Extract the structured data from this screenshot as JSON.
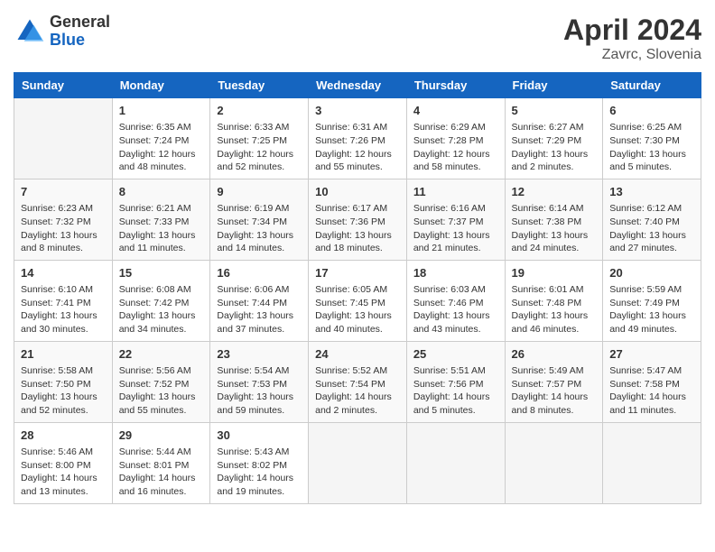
{
  "header": {
    "logo_general": "General",
    "logo_blue": "Blue",
    "month_year": "April 2024",
    "location": "Zavrc, Slovenia"
  },
  "days_of_week": [
    "Sunday",
    "Monday",
    "Tuesday",
    "Wednesday",
    "Thursday",
    "Friday",
    "Saturday"
  ],
  "weeks": [
    [
      {
        "day": "",
        "content": ""
      },
      {
        "day": "1",
        "content": "Sunrise: 6:35 AM\nSunset: 7:24 PM\nDaylight: 12 hours\nand 48 minutes."
      },
      {
        "day": "2",
        "content": "Sunrise: 6:33 AM\nSunset: 7:25 PM\nDaylight: 12 hours\nand 52 minutes."
      },
      {
        "day": "3",
        "content": "Sunrise: 6:31 AM\nSunset: 7:26 PM\nDaylight: 12 hours\nand 55 minutes."
      },
      {
        "day": "4",
        "content": "Sunrise: 6:29 AM\nSunset: 7:28 PM\nDaylight: 12 hours\nand 58 minutes."
      },
      {
        "day": "5",
        "content": "Sunrise: 6:27 AM\nSunset: 7:29 PM\nDaylight: 13 hours\nand 2 minutes."
      },
      {
        "day": "6",
        "content": "Sunrise: 6:25 AM\nSunset: 7:30 PM\nDaylight: 13 hours\nand 5 minutes."
      }
    ],
    [
      {
        "day": "7",
        "content": "Sunrise: 6:23 AM\nSunset: 7:32 PM\nDaylight: 13 hours\nand 8 minutes."
      },
      {
        "day": "8",
        "content": "Sunrise: 6:21 AM\nSunset: 7:33 PM\nDaylight: 13 hours\nand 11 minutes."
      },
      {
        "day": "9",
        "content": "Sunrise: 6:19 AM\nSunset: 7:34 PM\nDaylight: 13 hours\nand 14 minutes."
      },
      {
        "day": "10",
        "content": "Sunrise: 6:17 AM\nSunset: 7:36 PM\nDaylight: 13 hours\nand 18 minutes."
      },
      {
        "day": "11",
        "content": "Sunrise: 6:16 AM\nSunset: 7:37 PM\nDaylight: 13 hours\nand 21 minutes."
      },
      {
        "day": "12",
        "content": "Sunrise: 6:14 AM\nSunset: 7:38 PM\nDaylight: 13 hours\nand 24 minutes."
      },
      {
        "day": "13",
        "content": "Sunrise: 6:12 AM\nSunset: 7:40 PM\nDaylight: 13 hours\nand 27 minutes."
      }
    ],
    [
      {
        "day": "14",
        "content": "Sunrise: 6:10 AM\nSunset: 7:41 PM\nDaylight: 13 hours\nand 30 minutes."
      },
      {
        "day": "15",
        "content": "Sunrise: 6:08 AM\nSunset: 7:42 PM\nDaylight: 13 hours\nand 34 minutes."
      },
      {
        "day": "16",
        "content": "Sunrise: 6:06 AM\nSunset: 7:44 PM\nDaylight: 13 hours\nand 37 minutes."
      },
      {
        "day": "17",
        "content": "Sunrise: 6:05 AM\nSunset: 7:45 PM\nDaylight: 13 hours\nand 40 minutes."
      },
      {
        "day": "18",
        "content": "Sunrise: 6:03 AM\nSunset: 7:46 PM\nDaylight: 13 hours\nand 43 minutes."
      },
      {
        "day": "19",
        "content": "Sunrise: 6:01 AM\nSunset: 7:48 PM\nDaylight: 13 hours\nand 46 minutes."
      },
      {
        "day": "20",
        "content": "Sunrise: 5:59 AM\nSunset: 7:49 PM\nDaylight: 13 hours\nand 49 minutes."
      }
    ],
    [
      {
        "day": "21",
        "content": "Sunrise: 5:58 AM\nSunset: 7:50 PM\nDaylight: 13 hours\nand 52 minutes."
      },
      {
        "day": "22",
        "content": "Sunrise: 5:56 AM\nSunset: 7:52 PM\nDaylight: 13 hours\nand 55 minutes."
      },
      {
        "day": "23",
        "content": "Sunrise: 5:54 AM\nSunset: 7:53 PM\nDaylight: 13 hours\nand 59 minutes."
      },
      {
        "day": "24",
        "content": "Sunrise: 5:52 AM\nSunset: 7:54 PM\nDaylight: 14 hours\nand 2 minutes."
      },
      {
        "day": "25",
        "content": "Sunrise: 5:51 AM\nSunset: 7:56 PM\nDaylight: 14 hours\nand 5 minutes."
      },
      {
        "day": "26",
        "content": "Sunrise: 5:49 AM\nSunset: 7:57 PM\nDaylight: 14 hours\nand 8 minutes."
      },
      {
        "day": "27",
        "content": "Sunrise: 5:47 AM\nSunset: 7:58 PM\nDaylight: 14 hours\nand 11 minutes."
      }
    ],
    [
      {
        "day": "28",
        "content": "Sunrise: 5:46 AM\nSunset: 8:00 PM\nDaylight: 14 hours\nand 13 minutes."
      },
      {
        "day": "29",
        "content": "Sunrise: 5:44 AM\nSunset: 8:01 PM\nDaylight: 14 hours\nand 16 minutes."
      },
      {
        "day": "30",
        "content": "Sunrise: 5:43 AM\nSunset: 8:02 PM\nDaylight: 14 hours\nand 19 minutes."
      },
      {
        "day": "",
        "content": ""
      },
      {
        "day": "",
        "content": ""
      },
      {
        "day": "",
        "content": ""
      },
      {
        "day": "",
        "content": ""
      }
    ]
  ]
}
